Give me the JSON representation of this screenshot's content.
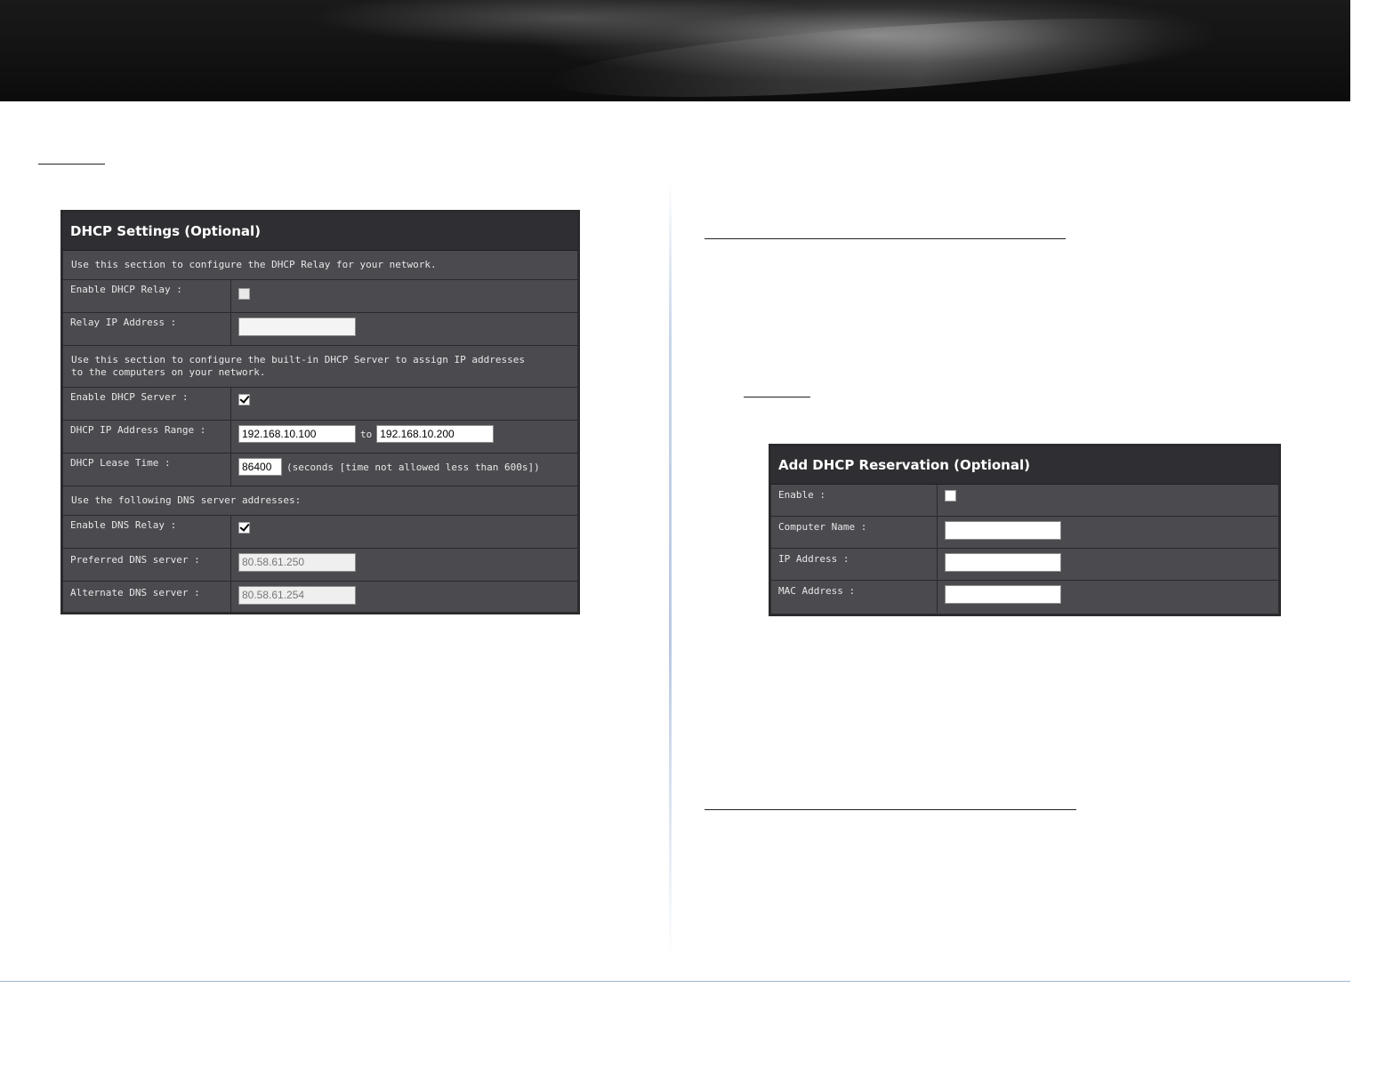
{
  "dhcp_settings": {
    "title": "DHCP Settings (Optional)",
    "relay_note": "Use this section to configure the DHCP Relay for your network.",
    "enable_relay_label": "Enable DHCP Relay :",
    "enable_relay_checked": false,
    "relay_ip_label": "Relay IP Address :",
    "relay_ip_value": "",
    "server_note": "Use this section to configure the built-in DHCP Server to assign IP addresses to the computers on your network.",
    "enable_server_label": "Enable DHCP Server :",
    "enable_server_checked": true,
    "range_label": "DHCP IP Address Range :",
    "range_start": "192.168.10.100",
    "range_to": "to",
    "range_end": "192.168.10.200",
    "lease_label": "DHCP Lease Time :",
    "lease_value": "86400",
    "lease_note": "(seconds [time not allowed less than 600s])",
    "dns_note": "Use the following DNS server addresses:",
    "enable_dns_relay_label": "Enable DNS Relay :",
    "enable_dns_relay_checked": true,
    "preferred_dns_label": "Preferred DNS server :",
    "preferred_dns_value": "80.58.61.250",
    "alternate_dns_label": "Alternate DNS server :",
    "alternate_dns_value": "80.58.61.254"
  },
  "reservation": {
    "title": "Add DHCP Reservation (Optional)",
    "enable_label": "Enable :",
    "enable_checked": false,
    "computer_name_label": "Computer Name :",
    "computer_name_value": "",
    "ip_label": "IP Address :",
    "ip_value": "",
    "mac_label": "MAC Address :",
    "mac_value": ""
  },
  "colors": {
    "panel_bg": "#4a4a4f",
    "panel_title_bg": "#2f2f33",
    "footer_rule": "#9fb6d3"
  }
}
